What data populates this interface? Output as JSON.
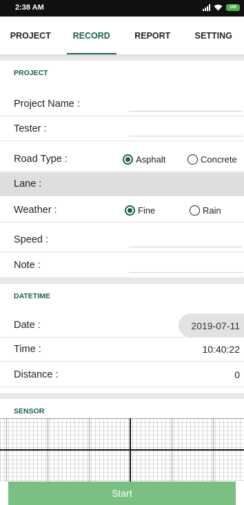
{
  "status_bar": {
    "time": "2:38 AM",
    "battery": "100"
  },
  "tabs": [
    {
      "label": "PROJECT",
      "active": false
    },
    {
      "label": "RECORD",
      "active": true
    },
    {
      "label": "REPORT",
      "active": false
    },
    {
      "label": "SETTING",
      "active": false
    }
  ],
  "project_section": {
    "title": "PROJECT",
    "project_name_label": "Project Name :",
    "project_name_value": "",
    "tester_label": "Tester :",
    "tester_value": "",
    "road_type_label": "Road Type :",
    "road_type_options": [
      "Asphalt",
      "Concrete"
    ],
    "road_type_selected": "Asphalt",
    "lane_label": "Lane :",
    "weather_label": "Weather :",
    "weather_options": [
      "Fine",
      "Rain"
    ],
    "weather_selected": "Fine",
    "speed_label": "Speed :",
    "speed_value": "",
    "note_label": "Note :",
    "note_value": ""
  },
  "datetime_section": {
    "title": "DATETIME",
    "date_label": "Date :",
    "date_value": "2019-07-11",
    "time_label": "Time :",
    "time_value": "10:40:22",
    "distance_label": "Distance :",
    "distance_value": "0"
  },
  "sensor_section": {
    "title": "SENSOR"
  },
  "actions": {
    "start_label": "Start"
  },
  "colors": {
    "accent": "#1b5e4a",
    "start_button": "#7bbf82",
    "section_gap": "#e8e8e8",
    "lane_row": "#dedede"
  }
}
